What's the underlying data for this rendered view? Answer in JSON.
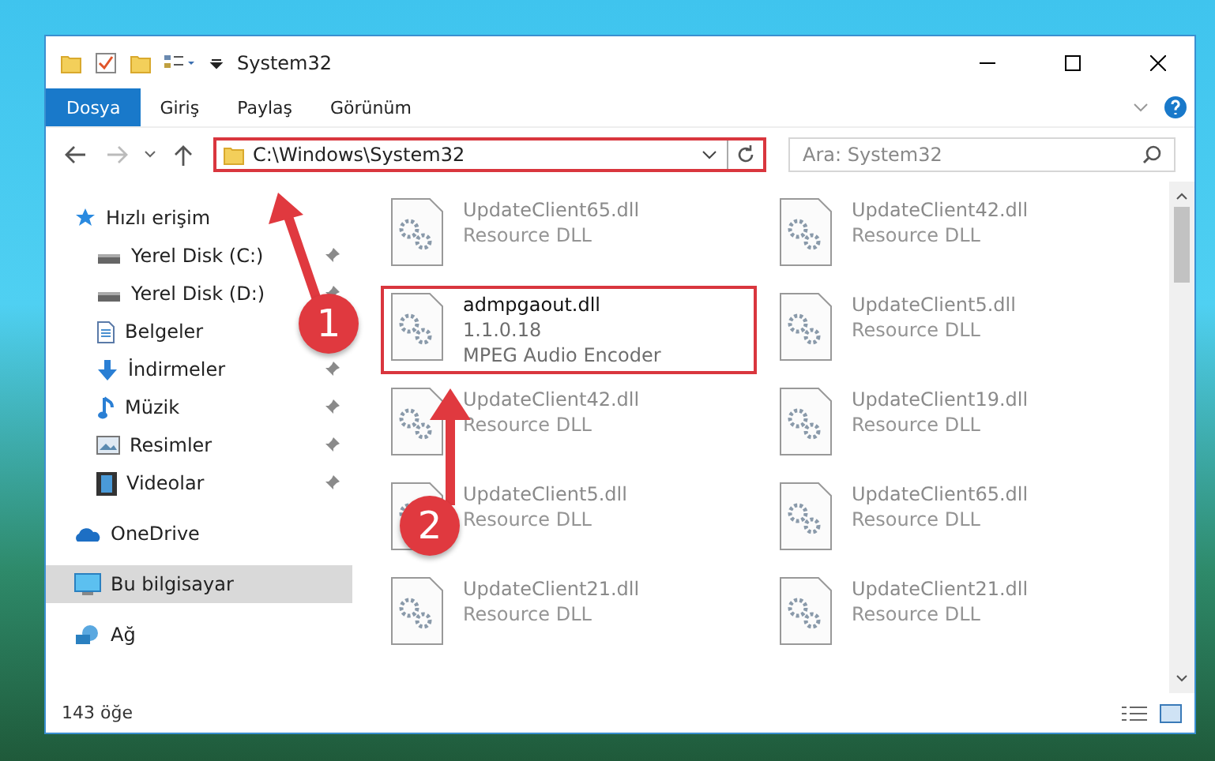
{
  "window": {
    "title": "System32"
  },
  "ribbon": {
    "file_button": "Dosya",
    "tabs": [
      "Giriş",
      "Paylaş",
      "Görünüm"
    ]
  },
  "address": {
    "path": "C:\\Windows\\System32"
  },
  "search": {
    "placeholder": "Ara: System32"
  },
  "sidebar": {
    "items": [
      {
        "label": "Hızlı erişim",
        "kind": "star",
        "selected": false,
        "children": [
          {
            "label": "Yerel Disk (C:)",
            "kind": "disk",
            "pinned": true
          },
          {
            "label": "Yerel Disk (D:)",
            "kind": "disk",
            "pinned": true
          },
          {
            "label": "Belgeler",
            "kind": "document"
          },
          {
            "label": "İndirmeler",
            "kind": "download",
            "pinned": true
          },
          {
            "label": "Müzik",
            "kind": "music",
            "pinned": true
          },
          {
            "label": "Resimler",
            "kind": "picture",
            "pinned": true
          },
          {
            "label": "Videolar",
            "kind": "video",
            "pinned": true
          }
        ]
      },
      {
        "label": "OneDrive",
        "kind": "cloud",
        "selected": false
      },
      {
        "label": "Bu bilgisayar",
        "kind": "computer",
        "selected": true
      },
      {
        "label": "Ağ",
        "kind": "network",
        "selected": false
      }
    ]
  },
  "files": [
    {
      "name": "UpdateClient65.dll",
      "lines": [
        "Resource DLL"
      ],
      "highlighted": false
    },
    {
      "name": "UpdateClient42.dll",
      "lines": [
        "Resource DLL"
      ],
      "highlighted": false
    },
    {
      "name": "admpgaout.dll",
      "lines": [
        "1.1.0.18",
        "MPEG Audio Encoder"
      ],
      "highlighted": true
    },
    {
      "name": "UpdateClient5.dll",
      "lines": [
        "Resource DLL"
      ],
      "highlighted": false
    },
    {
      "name": "UpdateClient42.dll",
      "lines": [
        "Resource DLL"
      ],
      "highlighted": false
    },
    {
      "name": "UpdateClient19.dll",
      "lines": [
        "Resource DLL"
      ],
      "highlighted": false
    },
    {
      "name": "UpdateClient5.dll",
      "lines": [
        "Resource DLL"
      ],
      "highlighted": false
    },
    {
      "name": "UpdateClient65.dll",
      "lines": [
        "Resource DLL"
      ],
      "highlighted": false
    },
    {
      "name": "UpdateClient21.dll",
      "lines": [
        "Resource DLL"
      ],
      "highlighted": false
    },
    {
      "name": "UpdateClient21.dll",
      "lines": [
        "Resource DLL"
      ],
      "highlighted": false
    }
  ],
  "status_bar": {
    "count": "143 öğe"
  },
  "annotations": [
    {
      "number": "1"
    },
    {
      "number": "2"
    }
  ]
}
